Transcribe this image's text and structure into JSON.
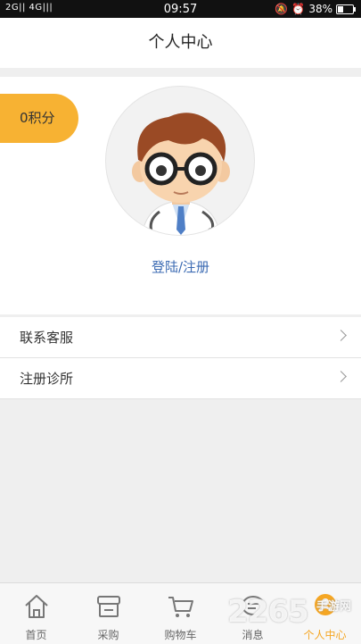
{
  "status_bar": {
    "signal": "2G|| 4G|||",
    "time": "09:57",
    "battery": "38%"
  },
  "header": {
    "title": "个人中心"
  },
  "profile": {
    "points": "0积分",
    "login_label": "登陆/注册",
    "avatar_icon": "doctor-avatar"
  },
  "menu": {
    "items": [
      {
        "label": "联系客服"
      },
      {
        "label": "注册诊所"
      }
    ]
  },
  "tabs": [
    {
      "label": "首页",
      "icon": "home-icon"
    },
    {
      "label": "采购",
      "icon": "store-icon"
    },
    {
      "label": "购物车",
      "icon": "cart-icon"
    },
    {
      "label": "消息",
      "icon": "message-icon"
    },
    {
      "label": "个人中心",
      "icon": "user-icon",
      "active": true
    }
  ],
  "watermark": {
    "main": "2265",
    "sub": "手游网"
  },
  "colors": {
    "accent": "#f7b233",
    "link": "#3c6bb3"
  }
}
